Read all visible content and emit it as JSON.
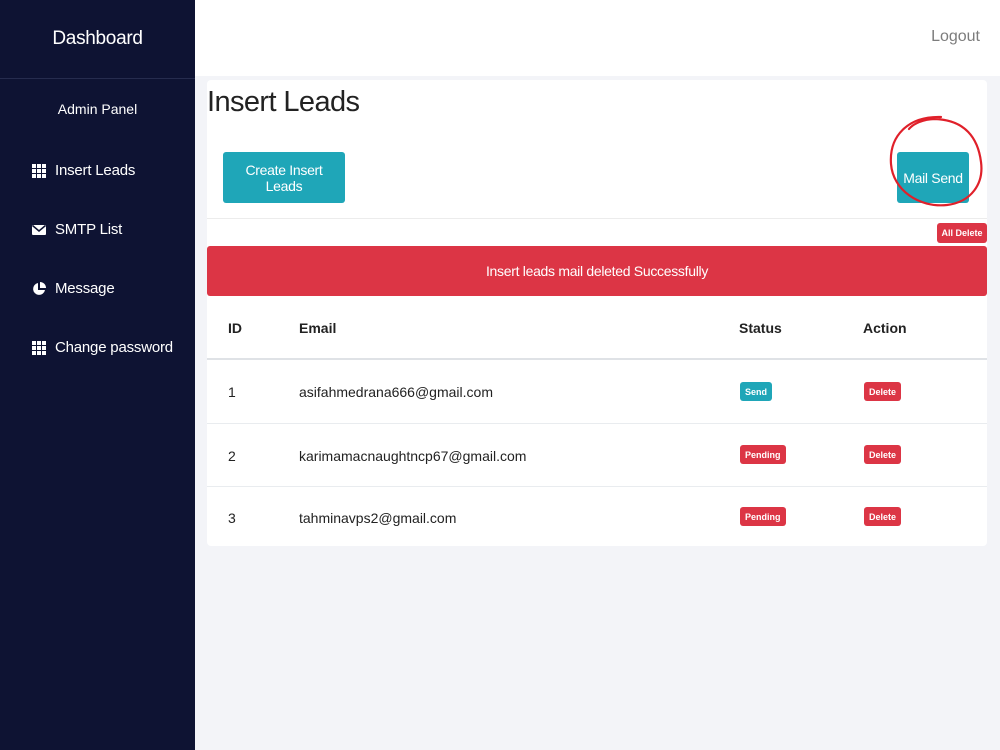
{
  "sidebar": {
    "brand": "Dashboard",
    "section_title": "Admin Panel",
    "items": [
      {
        "label": "Insert Leads",
        "icon": "grid-icon"
      },
      {
        "label": "SMTP List",
        "icon": "envelope-icon"
      },
      {
        "label": "Message",
        "icon": "pie-chart-icon"
      },
      {
        "label": "Change password",
        "icon": "grid-icon"
      }
    ]
  },
  "topbar": {
    "logout": "Logout"
  },
  "main": {
    "title": "Insert Leads",
    "create_button": "Create Insert Leads",
    "mail_send_button": "Mail Send",
    "all_delete_button": "All Delete",
    "alert": "Insert leads mail deleted Successfully",
    "table": {
      "headers": [
        "ID",
        "Email",
        "Status",
        "Action"
      ],
      "rows": [
        {
          "id": "1",
          "email": "asifahmedrana666@gmail.com",
          "status": "Send",
          "action": "Delete"
        },
        {
          "id": "2",
          "email": "karimamacnaughtncp67@gmail.com",
          "status": "Pending",
          "action": "Delete"
        },
        {
          "id": "3",
          "email": "tahminavps2@gmail.com",
          "status": "Pending",
          "action": "Delete"
        }
      ]
    }
  },
  "colors": {
    "sidebar_bg": "#0e1333",
    "teal": "#1fa6b8",
    "danger": "#dc3545",
    "annotation": "#e0202a"
  }
}
